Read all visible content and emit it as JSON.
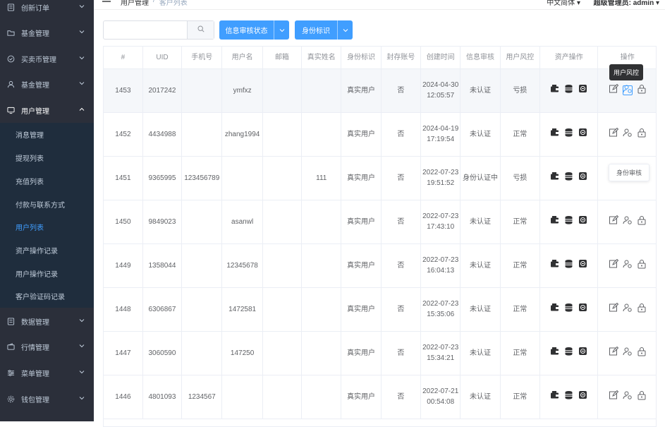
{
  "sidebar": {
    "items": [
      {
        "label": "创新订单",
        "icon": "document-icon"
      },
      {
        "label": "基金管理",
        "icon": "folder-icon"
      },
      {
        "label": "买卖币管理",
        "icon": "check-circle-icon"
      },
      {
        "label": "基金管理",
        "icon": "user-icon"
      },
      {
        "label": "用户管理",
        "icon": "monitor-icon"
      }
    ],
    "subitems": [
      {
        "label": "消息管理"
      },
      {
        "label": "提现列表"
      },
      {
        "label": "充值列表"
      },
      {
        "label": "付款与联系方式"
      },
      {
        "label": "用户列表"
      },
      {
        "label": "资产操作记录"
      },
      {
        "label": "用户操作记录"
      },
      {
        "label": "客户验证码记录"
      }
    ],
    "lower": [
      {
        "label": "数据管理",
        "icon": "document-icon"
      },
      {
        "label": "行情管理",
        "icon": "wallet-icon"
      },
      {
        "label": "菜单管理",
        "icon": "sliders-icon"
      },
      {
        "label": "钱包管理",
        "icon": "gear-icon"
      }
    ]
  },
  "topbar": {
    "crumb_parent": "用户管理",
    "crumb_sep": "/",
    "crumb_current": "客户列表",
    "lang": "中文简体",
    "user": "超级管理员: admin"
  },
  "toolbar": {
    "search_placeholder": "",
    "filter1_label": "信息审核状态",
    "filter2_label": "身份标识"
  },
  "table": {
    "headers": [
      "#",
      "UID",
      "手机号",
      "用户名",
      "邮箱",
      "真实姓名",
      "身份标识",
      "封存账号",
      "创建时间",
      "信息审核",
      "用户风控",
      "资产操作",
      "操作"
    ],
    "rows": [
      {
        "id": "1453",
        "uid": "2017242",
        "phone": "",
        "username": "ymfxz",
        "email": "",
        "realname": "",
        "identity": "真实用户",
        "frozen": "否",
        "created": "2024-04-30 12:05:57",
        "review": "未认证",
        "risk": "亏损"
      },
      {
        "id": "1452",
        "uid": "4434988",
        "phone": "",
        "username": "zhang1994",
        "email": "",
        "realname": "",
        "identity": "真实用户",
        "frozen": "否",
        "created": "2024-04-19 17:19:54",
        "review": "未认证",
        "risk": "正常"
      },
      {
        "id": "1451",
        "uid": "9365995",
        "phone": "123456789",
        "username": "",
        "email": "",
        "realname": "111",
        "identity": "真实用户",
        "frozen": "否",
        "created": "2022-07-23 19:51:52",
        "review": "身份认证中",
        "risk": "亏损"
      },
      {
        "id": "1450",
        "uid": "9849023",
        "phone": "",
        "username": "asanwl",
        "email": "",
        "realname": "",
        "identity": "真实用户",
        "frozen": "否",
        "created": "2022-07-23 17:43:10",
        "review": "未认证",
        "risk": "正常"
      },
      {
        "id": "1449",
        "uid": "1358044",
        "phone": "",
        "username": "12345678",
        "email": "",
        "realname": "",
        "identity": "真实用户",
        "frozen": "否",
        "created": "2022-07-23 16:04:13",
        "review": "未认证",
        "risk": "正常"
      },
      {
        "id": "1448",
        "uid": "6306867",
        "phone": "",
        "username": "1472581",
        "email": "",
        "realname": "",
        "identity": "真实用户",
        "frozen": "否",
        "created": "2022-07-23 15:35:06",
        "review": "未认证",
        "risk": "正常"
      },
      {
        "id": "1447",
        "uid": "3060590",
        "phone": "",
        "username": "147250",
        "email": "",
        "realname": "",
        "identity": "真实用户",
        "frozen": "否",
        "created": "2022-07-23 15:34:21",
        "review": "未认证",
        "risk": "正常"
      },
      {
        "id": "1446",
        "uid": "4801093",
        "phone": "1234567",
        "username": "",
        "email": "",
        "realname": "",
        "identity": "真实用户",
        "frozen": "否",
        "created": "2022-07-21 00:54:08",
        "review": "未认证",
        "risk": "正常"
      }
    ]
  },
  "tooltips": {
    "risk": "用户风控",
    "review": "身份审核"
  },
  "colors": {
    "sidebar_bg": "#2b2f3a",
    "submenu_bg": "#1f2d3d",
    "accent": "#409eff"
  }
}
